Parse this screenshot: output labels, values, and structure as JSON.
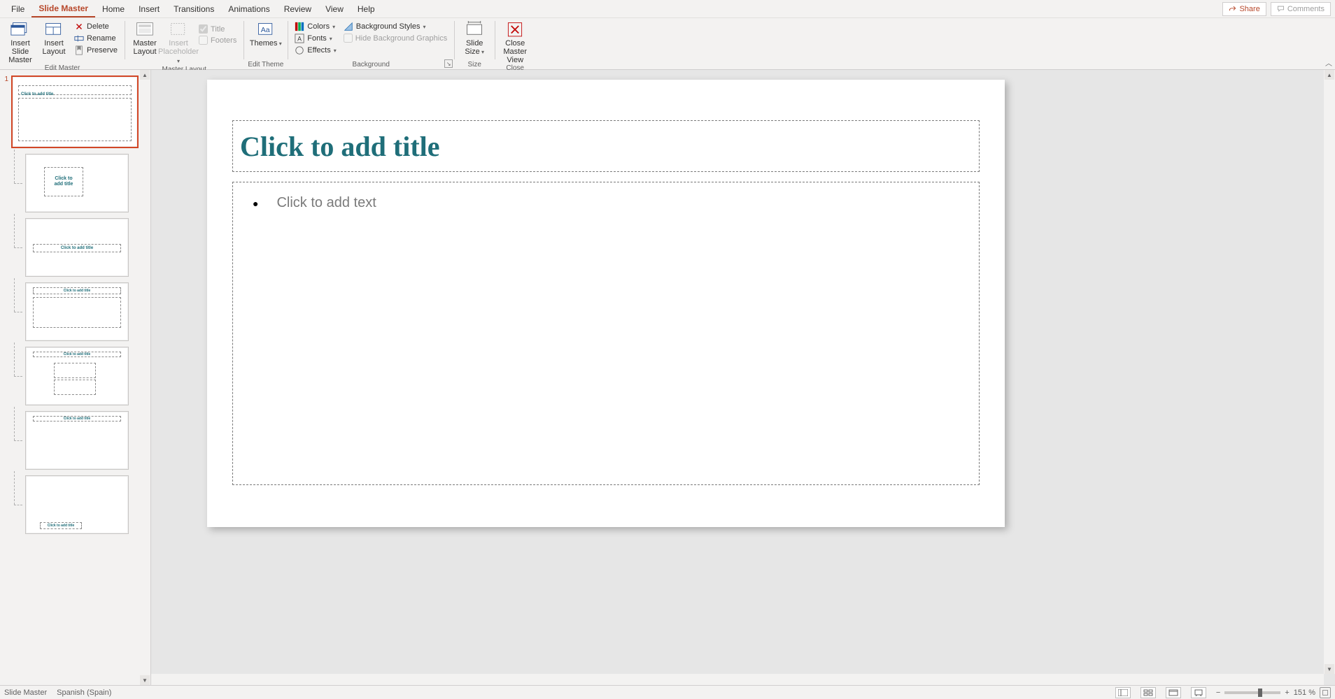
{
  "tabs": {
    "file": "File",
    "slideMaster": "Slide Master",
    "home": "Home",
    "insert": "Insert",
    "transitions": "Transitions",
    "animations": "Animations",
    "review": "Review",
    "view": "View",
    "help": "Help"
  },
  "titleButtons": {
    "share": "Share",
    "comments": "Comments"
  },
  "ribbon": {
    "editMaster": {
      "label": "Edit Master",
      "insertSlideMaster": "Insert Slide\nMaster",
      "insertLayout": "Insert\nLayout",
      "delete": "Delete",
      "rename": "Rename",
      "preserve": "Preserve"
    },
    "masterLayout": {
      "label": "Master Layout",
      "masterLayout": "Master\nLayout",
      "insertPlaceholder": "Insert\nPlaceholder",
      "title": "Title",
      "footers": "Footers"
    },
    "editTheme": {
      "label": "Edit Theme",
      "themes": "Themes"
    },
    "background": {
      "label": "Background",
      "colors": "Colors",
      "fonts": "Fonts",
      "effects": "Effects",
      "bgStyles": "Background Styles",
      "hideBg": "Hide Background Graphics"
    },
    "size": {
      "label": "Size",
      "slideSize": "Slide\nSize"
    },
    "close": {
      "label": "Close",
      "closeMaster": "Close\nMaster View"
    }
  },
  "slide": {
    "titlePlaceholder": "Click to add title",
    "bodyPlaceholder": "Click to add text"
  },
  "thumbs": {
    "masterNumber": "1",
    "titleText": "Click to add title",
    "layoutTitleText": "Click to add title"
  },
  "status": {
    "mode": "Slide Master",
    "language": "Spanish (Spain)",
    "zoom": "151 %"
  }
}
